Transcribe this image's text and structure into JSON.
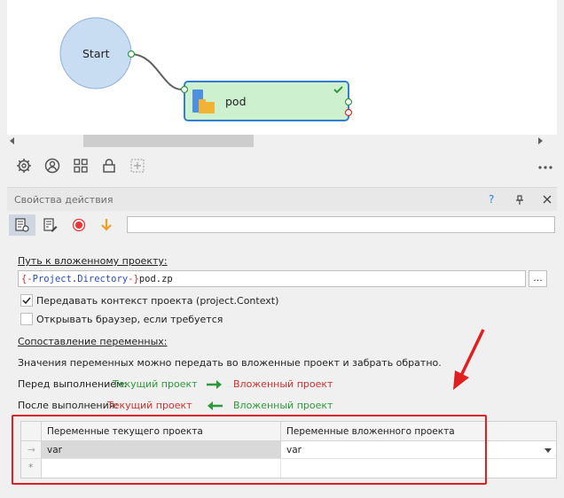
{
  "canvas": {
    "start_node": {
      "label": "Start"
    },
    "pod_node": {
      "label": "pod"
    }
  },
  "properties": {
    "title": "Свойства действия",
    "help_label": "?",
    "path_label": "Путь к вложенному проекту:",
    "path_value_open": "{-",
    "path_value_project": "Project",
    "path_value_dot": ".",
    "path_value_directory": "Directory",
    "path_value_close": "-}",
    "path_value_tail": "pod.zp",
    "browse_label": "...",
    "checkbox_context": {
      "label": "Передавать контекст проекта (project.Context)",
      "checked": true
    },
    "checkbox_browser": {
      "label": "Открывать браузер, если требуется",
      "checked": false
    },
    "mapping_label": "Сопоставление переменных:",
    "mapping_desc": "Значения переменных можно передать во вложенные проект и забрать обратно.",
    "before_label": "Перед выполнением:",
    "before_from": "Текущий проект",
    "before_to": "Вложенный проект",
    "after_label": "После выполнения:",
    "after_from": "Текущий проект",
    "after_to": "Вложенный проект"
  },
  "grid": {
    "columns": [
      "Переменные текущего проекта",
      "Переменные вложенного проекта"
    ],
    "rows": [
      {
        "current": "var",
        "nested": "var"
      }
    ],
    "new_row_marker": "*"
  },
  "colors": {
    "green_text": "#2c9a3a",
    "red_text": "#d03030",
    "node_fill": "#cdf0cf",
    "node_border": "#2f7fd6",
    "start_fill": "#c8dcf2"
  }
}
